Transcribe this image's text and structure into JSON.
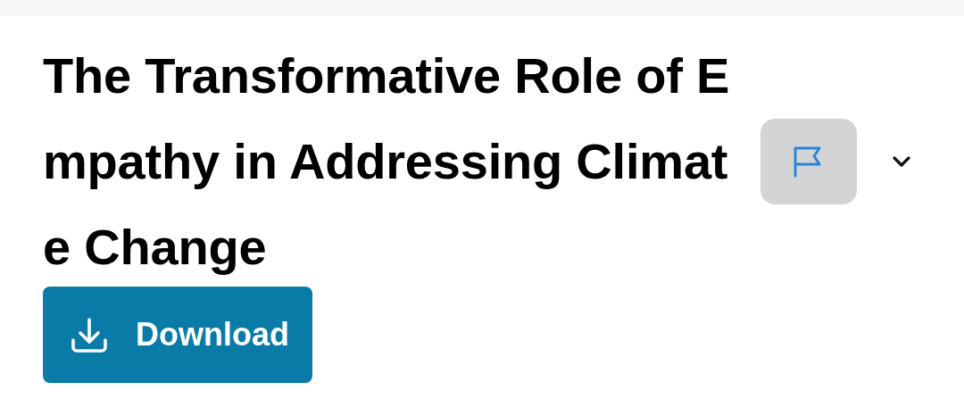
{
  "title": "The Transformative Role of Empathy in Addressing Climate Change",
  "flag_button": {
    "disabled": false
  },
  "download_button": {
    "label": "Download"
  }
}
